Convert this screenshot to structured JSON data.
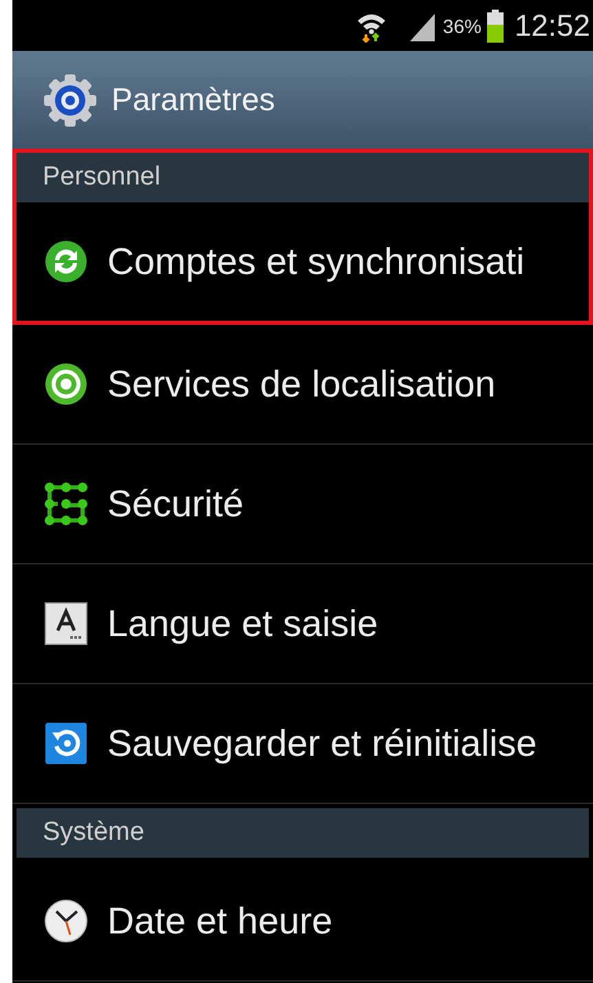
{
  "status_bar": {
    "battery": "36%",
    "time": "12:52"
  },
  "action_bar": {
    "title": "Paramètres"
  },
  "sections": [
    {
      "title": "Personnel",
      "highlighted": true,
      "items": [
        {
          "label": "Comptes et synchronisati",
          "kind": "sync",
          "highlighted": true
        },
        {
          "label": "Services de localisation",
          "kind": "location",
          "highlighted": false
        },
        {
          "label": "Sécurité",
          "kind": "security",
          "highlighted": false
        },
        {
          "label": "Langue et saisie",
          "kind": "language",
          "highlighted": false
        },
        {
          "label": "Sauvegarder et réinitialise",
          "kind": "backup",
          "highlighted": false
        }
      ]
    },
    {
      "title": "Système",
      "highlighted": false,
      "items": [
        {
          "label": "Date et heure",
          "kind": "clock",
          "highlighted": false
        }
      ]
    }
  ]
}
